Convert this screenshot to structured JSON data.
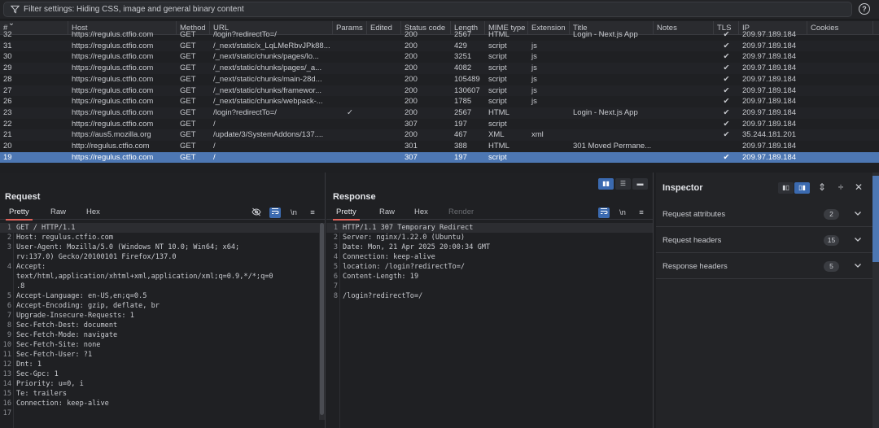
{
  "filter": {
    "text": "Filter settings: Hiding CSS, image and general binary content"
  },
  "table": {
    "columns": [
      "#",
      "Host",
      "Method",
      "URL",
      "Params",
      "Edited",
      "Status code",
      "Length",
      "MIME type",
      "Extension",
      "Title",
      "Notes",
      "TLS",
      "IP",
      "Cookies"
    ],
    "rows": [
      {
        "id": "32",
        "host": "https://regulus.ctfio.com",
        "method": "GET",
        "url": "/login?redirectTo=/",
        "params": "",
        "status": "200",
        "length": "2567",
        "mime": "HTML",
        "ext": "",
        "title": "Login - Next.js App",
        "tls": true,
        "ip": "209.97.189.184"
      },
      {
        "id": "31",
        "host": "https://regulus.ctfio.com",
        "method": "GET",
        "url": "/_next/static/x_LqLMeRbvJPk88...",
        "params": "",
        "status": "200",
        "length": "429",
        "mime": "script",
        "ext": "js",
        "title": "",
        "tls": true,
        "ip": "209.97.189.184"
      },
      {
        "id": "30",
        "host": "https://regulus.ctfio.com",
        "method": "GET",
        "url": "/_next/static/chunks/pages/lo...",
        "params": "",
        "status": "200",
        "length": "3251",
        "mime": "script",
        "ext": "js",
        "title": "",
        "tls": true,
        "ip": "209.97.189.184"
      },
      {
        "id": "29",
        "host": "https://regulus.ctfio.com",
        "method": "GET",
        "url": "/_next/static/chunks/pages/_a...",
        "params": "",
        "status": "200",
        "length": "4082",
        "mime": "script",
        "ext": "js",
        "title": "",
        "tls": true,
        "ip": "209.97.189.184"
      },
      {
        "id": "28",
        "host": "https://regulus.ctfio.com",
        "method": "GET",
        "url": "/_next/static/chunks/main-28d...",
        "params": "",
        "status": "200",
        "length": "105489",
        "mime": "script",
        "ext": "js",
        "title": "",
        "tls": true,
        "ip": "209.97.189.184"
      },
      {
        "id": "27",
        "host": "https://regulus.ctfio.com",
        "method": "GET",
        "url": "/_next/static/chunks/framewor...",
        "params": "",
        "status": "200",
        "length": "130607",
        "mime": "script",
        "ext": "js",
        "title": "",
        "tls": true,
        "ip": "209.97.189.184"
      },
      {
        "id": "26",
        "host": "https://regulus.ctfio.com",
        "method": "GET",
        "url": "/_next/static/chunks/webpack-...",
        "params": "",
        "status": "200",
        "length": "1785",
        "mime": "script",
        "ext": "js",
        "title": "",
        "tls": true,
        "ip": "209.97.189.184"
      },
      {
        "id": "23",
        "host": "https://regulus.ctfio.com",
        "method": "GET",
        "url": "/login?redirectTo=/",
        "params": "✓",
        "status": "200",
        "length": "2567",
        "mime": "HTML",
        "ext": "",
        "title": "Login - Next.js App",
        "tls": true,
        "ip": "209.97.189.184"
      },
      {
        "id": "22",
        "host": "https://regulus.ctfio.com",
        "method": "GET",
        "url": "/",
        "params": "",
        "status": "307",
        "length": "197",
        "mime": "script",
        "ext": "",
        "title": "",
        "tls": true,
        "ip": "209.97.189.184"
      },
      {
        "id": "21",
        "host": "https://aus5.mozilla.org",
        "method": "GET",
        "url": "/update/3/SystemAddons/137....",
        "params": "",
        "status": "200",
        "length": "467",
        "mime": "XML",
        "ext": "xml",
        "title": "",
        "tls": true,
        "ip": "35.244.181.201"
      },
      {
        "id": "20",
        "host": "http://regulus.ctfio.com",
        "method": "GET",
        "url": "/",
        "params": "",
        "status": "301",
        "length": "388",
        "mime": "HTML",
        "ext": "",
        "title": "301 Moved Permane...",
        "tls": false,
        "ip": "209.97.189.184"
      },
      {
        "id": "19",
        "host": "https://regulus.ctfio.com",
        "method": "GET",
        "url": "/",
        "params": "",
        "status": "307",
        "length": "197",
        "mime": "script",
        "ext": "",
        "title": "",
        "tls": true,
        "ip": "209.97.189.184",
        "selected": true
      }
    ]
  },
  "request": {
    "title": "Request",
    "tabs": [
      "Pretty",
      "Raw",
      "Hex"
    ],
    "lines": [
      {
        "n": "1",
        "t": "GET / HTTP/1.1"
      },
      {
        "n": "2",
        "t": "Host: regulus.ctfio.com"
      },
      {
        "n": "3",
        "t": "User-Agent: Mozilla/5.0 (Windows NT 10.0; Win64; x64;"
      },
      {
        "n": "",
        "t": "rv:137.0) Gecko/20100101 Firefox/137.0"
      },
      {
        "n": "4",
        "t": "Accept:"
      },
      {
        "n": "",
        "t": "text/html,application/xhtml+xml,application/xml;q=0.9,*/*;q=0"
      },
      {
        "n": "",
        "t": ".8"
      },
      {
        "n": "5",
        "t": "Accept-Language: en-US,en;q=0.5"
      },
      {
        "n": "6",
        "t": "Accept-Encoding: gzip, deflate, br"
      },
      {
        "n": "7",
        "t": "Upgrade-Insecure-Requests: 1"
      },
      {
        "n": "8",
        "t": "Sec-Fetch-Dest: document"
      },
      {
        "n": "9",
        "t": "Sec-Fetch-Mode: navigate"
      },
      {
        "n": "10",
        "t": "Sec-Fetch-Site: none"
      },
      {
        "n": "11",
        "t": "Sec-Fetch-User: ?1"
      },
      {
        "n": "12",
        "t": "Dnt: 1"
      },
      {
        "n": "13",
        "t": "Sec-Gpc: 1"
      },
      {
        "n": "14",
        "t": "Priority: u=0, i"
      },
      {
        "n": "15",
        "t": "Te: trailers"
      },
      {
        "n": "16",
        "t": "Connection: keep-alive"
      },
      {
        "n": "17",
        "t": ""
      }
    ]
  },
  "response": {
    "title": "Response",
    "tabs": [
      "Pretty",
      "Raw",
      "Hex",
      "Render"
    ],
    "lines": [
      {
        "n": "1",
        "t": "HTTP/1.1 307 Temporary Redirect"
      },
      {
        "n": "2",
        "t": "Server: nginx/1.22.0 (Ubuntu)"
      },
      {
        "n": "3",
        "t": "Date: Mon, 21 Apr 2025 20:00:34 GMT"
      },
      {
        "n": "4",
        "t": "Connection: keep-alive"
      },
      {
        "n": "5",
        "t": "location: /login?redirectTo=/"
      },
      {
        "n": "6",
        "t": "Content-Length: 19"
      },
      {
        "n": "7",
        "t": ""
      },
      {
        "n": "8",
        "t": "/login?redirectTo=/"
      }
    ]
  },
  "inspector": {
    "title": "Inspector",
    "sections": [
      {
        "label": "Request attributes",
        "count": "2"
      },
      {
        "label": "Request headers",
        "count": "15"
      },
      {
        "label": "Response headers",
        "count": "5"
      }
    ]
  }
}
